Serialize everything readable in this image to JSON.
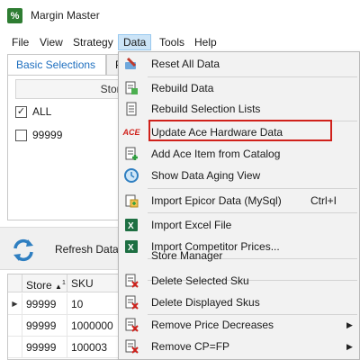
{
  "window": {
    "title": "Margin Master",
    "app_icon_glyph": "%"
  },
  "menubar": {
    "items": [
      "File",
      "View",
      "Strategy",
      "Data",
      "Tools",
      "Help"
    ],
    "active": "Data"
  },
  "tabs": [
    "Basic Selections",
    "P"
  ],
  "store_panel": {
    "header": "Store Numbe",
    "rows": [
      {
        "label": "ALL",
        "checked": true
      },
      {
        "label": "99999",
        "checked": false
      }
    ]
  },
  "refresh": {
    "label": "Refresh Data"
  },
  "grid": {
    "columns": [
      "Store",
      "SKU"
    ],
    "sort_indicator": "1",
    "rows": [
      {
        "store": "99999",
        "sku": "10",
        "current": true
      },
      {
        "store": "99999",
        "sku": "1000000",
        "current": false
      },
      {
        "store": "99999",
        "sku": "100003",
        "current": false
      }
    ]
  },
  "data_menu": {
    "items": [
      {
        "label": "Reset All Data",
        "icon": "reset-data-icon"
      },
      {
        "label": "Rebuild Data",
        "icon": "rebuild-data-icon"
      },
      {
        "label": "Rebuild Selection Lists",
        "icon": "rebuild-lists-icon"
      },
      {
        "label": "Update Ace Hardware Data",
        "icon": "ace-logo-icon"
      },
      {
        "label": "Add Ace Item from Catalog",
        "icon": "add-item-icon"
      },
      {
        "label": "Show Data Aging View",
        "icon": "aging-view-icon"
      },
      {
        "label": "Import Epicor Data (MySql)",
        "icon": "import-epicor-icon",
        "shortcut": "Ctrl+I"
      },
      {
        "label": "Import Excel File",
        "icon": "excel-icon"
      },
      {
        "label": "Import Competitor Prices...",
        "icon": "excel-icon"
      },
      {
        "label": "Store Manager",
        "icon": ""
      },
      {
        "label": "Delete Selected Sku",
        "icon": "delete-sku-icon"
      },
      {
        "label": "Delete Displayed Skus",
        "icon": "delete-skus-icon"
      },
      {
        "label": "Remove Price Decreases",
        "icon": "remove-price-icon",
        "submenu": true
      },
      {
        "label": "Remove CP=FP",
        "icon": "remove-cp-icon",
        "submenu": true
      }
    ],
    "highlighted": "Update Ace Hardware Data",
    "ace_logo_text": "ACE"
  },
  "colors": {
    "accent": "#1e6fbf",
    "highlight_border": "#d0211b",
    "menu_bg": "#f2f2f2",
    "excel_green": "#1d6f42"
  }
}
